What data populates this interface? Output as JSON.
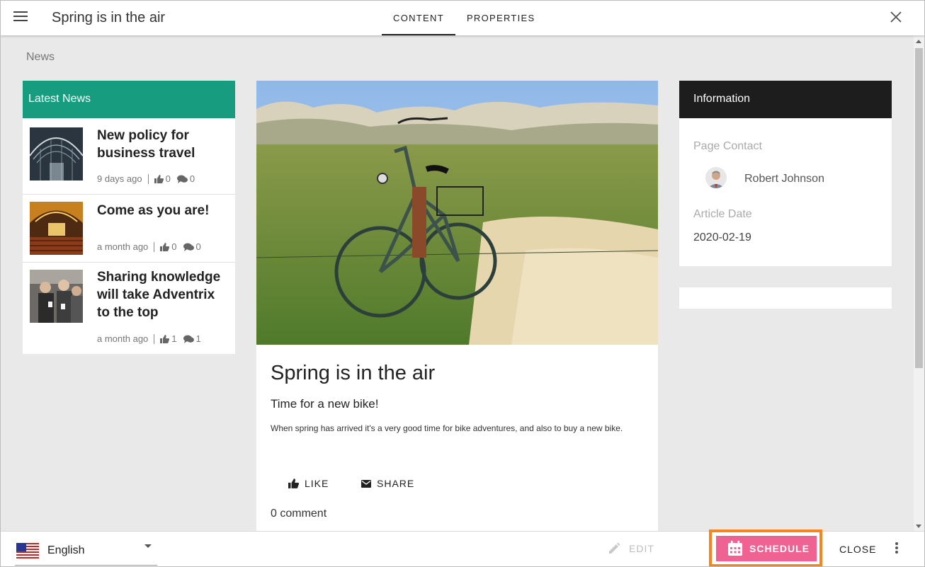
{
  "header": {
    "title": "Spring is in the air",
    "tabs": [
      {
        "label": "CONTENT",
        "active": true
      },
      {
        "label": "PROPERTIES",
        "active": false
      }
    ]
  },
  "breadcrumb": "News",
  "latest_news": {
    "title": "Latest News",
    "accent_color": "#179c80",
    "items": [
      {
        "title": "New policy for business travel",
        "age": "9 days ago",
        "likes": "0",
        "comments": "0"
      },
      {
        "title": "Come as you are!",
        "age": "a month ago",
        "likes": "0",
        "comments": "0"
      },
      {
        "title": "Sharing knowledge will take Adventrix to the top",
        "age": "a month ago",
        "likes": "1",
        "comments": "1"
      }
    ]
  },
  "article": {
    "title": "Spring is in the air",
    "subtitle": "Time for a new bike!",
    "body": "When spring has arrived it's a very good time for bike adventures, and also to buy a new bike.",
    "like_label": "LIKE",
    "share_label": "SHARE",
    "comments_label": "0 comment"
  },
  "information": {
    "title": "Information",
    "page_contact_label": "Page Contact",
    "contact_name": "Robert Johnson",
    "article_date_label": "Article Date",
    "article_date": "2020-02-19"
  },
  "footer": {
    "language": "English",
    "edit_label": "EDIT",
    "schedule_label": "SCHEDULE",
    "close_label": "CLOSE",
    "schedule_color": "#f06292",
    "highlight_color": "#f5861f"
  }
}
